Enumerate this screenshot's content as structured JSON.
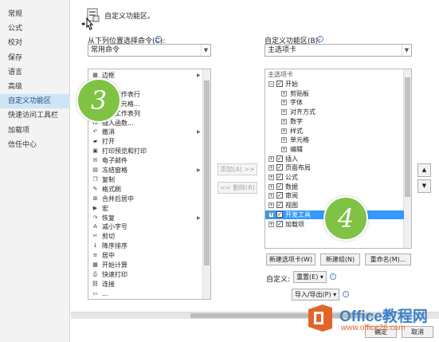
{
  "nav": {
    "items": [
      {
        "label": "常规"
      },
      {
        "label": "公式"
      },
      {
        "label": "校对"
      },
      {
        "label": "保存"
      },
      {
        "label": "语言"
      },
      {
        "label": "高级"
      },
      {
        "label": "自定义功能区",
        "active": true
      },
      {
        "label": "快速访问工具栏"
      },
      {
        "label": "加载项"
      },
      {
        "label": "信任中心"
      }
    ]
  },
  "header": {
    "title": "自定义功能区。"
  },
  "left_panel": {
    "label": "从下列位置选择命令(C):",
    "select_value": "常用命令",
    "commands": [
      {
        "icon": "borders-icon",
        "label": "边框",
        "glyph": "▦",
        "submenu": true
      },
      {
        "icon": "sort-icon",
        "label": "插入",
        "glyph": "▤"
      },
      {
        "icon": "table-row-icon",
        "label": "插入工作表行",
        "glyph": "▭"
      },
      {
        "icon": "cells-icon",
        "label": "插入单元格...",
        "glyph": "▦"
      },
      {
        "icon": "sheet-icon",
        "label": "插入工作表列",
        "glyph": "▥"
      },
      {
        "icon": "function-icon",
        "label": "插入函数...",
        "glyph": "fx"
      },
      {
        "icon": "undo-icon",
        "label": "撤消",
        "glyph": "↶",
        "submenu": true
      },
      {
        "icon": "open-folder-icon",
        "label": "打开",
        "glyph": "▰"
      },
      {
        "icon": "print-preview-icon",
        "label": "打印预览和打印",
        "glyph": "▣"
      },
      {
        "icon": "mail-icon",
        "label": "电子邮件",
        "glyph": "✉"
      },
      {
        "icon": "freeze-panes-icon",
        "label": "冻结窗格",
        "glyph": "▤",
        "submenu": true
      },
      {
        "icon": "copy-icon",
        "label": "复制",
        "glyph": "❐"
      },
      {
        "icon": "format-painter-icon",
        "label": "格式刷",
        "glyph": "✎"
      },
      {
        "icon": "merge-center-icon",
        "label": "合并后居中",
        "glyph": "⊞"
      },
      {
        "icon": "macro-icon",
        "label": "宏",
        "glyph": "▶"
      },
      {
        "icon": "redo-icon",
        "label": "恢复",
        "glyph": "↷",
        "submenu": true
      },
      {
        "icon": "font-size-decrease-icon",
        "label": "减小字号",
        "glyph": "A"
      },
      {
        "icon": "cut-icon",
        "label": "剪切",
        "glyph": "✂"
      },
      {
        "icon": "sort-descending-icon",
        "label": "降序排序",
        "glyph": "↓"
      },
      {
        "icon": "center-align-icon",
        "label": "居中",
        "glyph": "≡"
      },
      {
        "icon": "calculate-now-icon",
        "label": "开始计算",
        "glyph": "▦"
      },
      {
        "icon": "quick-print-icon",
        "label": "快速打印",
        "glyph": "⎙"
      },
      {
        "icon": "link-icon",
        "label": "连接",
        "glyph": "⛓"
      },
      {
        "icon": "more-icon",
        "label": "...",
        "glyph": "▭"
      }
    ]
  },
  "right_panel": {
    "label": "自定义功能区(B):",
    "select_value": "主选项卡",
    "tree_header": "主选项卡",
    "tree": [
      {
        "label": "开始",
        "level": 0,
        "expanded": true,
        "checked": true
      },
      {
        "label": "剪贴板",
        "level": 1
      },
      {
        "label": "字体",
        "level": 1
      },
      {
        "label": "对齐方式",
        "level": 1
      },
      {
        "label": "数字",
        "level": 1
      },
      {
        "label": "样式",
        "level": 1
      },
      {
        "label": "单元格",
        "level": 1
      },
      {
        "label": "编辑",
        "level": 1
      },
      {
        "label": "插入",
        "level": 0,
        "checked": true
      },
      {
        "label": "页面布局",
        "level": 0,
        "checked": true
      },
      {
        "label": "公式",
        "level": 0,
        "checked": true
      },
      {
        "label": "数据",
        "level": 0,
        "checked": true
      },
      {
        "label": "审阅",
        "level": 0,
        "checked": true
      },
      {
        "label": "视图",
        "level": 0,
        "checked": true
      },
      {
        "label": "开发工具",
        "level": 0,
        "checked": true,
        "selected": true
      },
      {
        "label": "加载项",
        "level": 0,
        "checked": true
      }
    ],
    "new_tab_button": "新建选项卡(W)",
    "new_group_button": "新建组(N)",
    "rename_button": "重命名(M)...",
    "customize_label": "自定义:",
    "reset_button": "重置(E) ▾",
    "import_export_button": "导入/导出(P) ▾"
  },
  "middle": {
    "add_button": "添加(A) >>",
    "remove_button": "<< 删除(R)"
  },
  "badges": {
    "left": "3",
    "right": "4"
  },
  "footer": {
    "ok_button": "确定",
    "cancel_button": "取消"
  },
  "watermark": {
    "name": "Office教程网",
    "url": "www.office26.com"
  },
  "colors": {
    "accent_badge": "#7fc244",
    "selection": "#3399ff",
    "nav_active": "#cfe4f5"
  }
}
